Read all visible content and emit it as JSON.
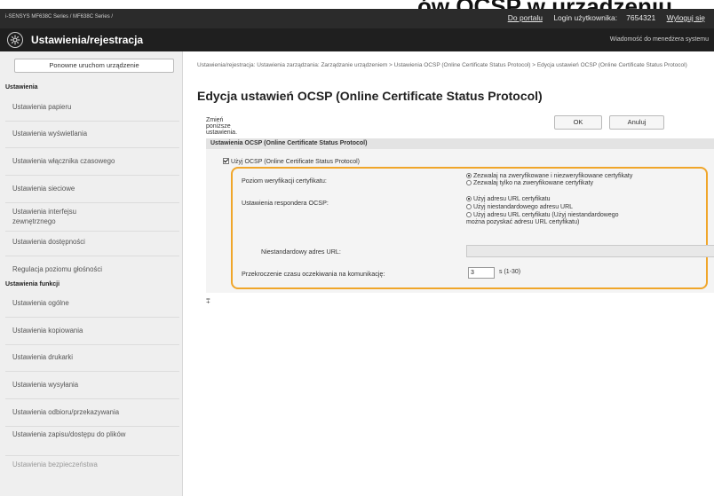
{
  "top_strip": {
    "overflow_text": "ów OCSP w urządzeniu"
  },
  "header": {
    "product": "i-SENSYS   MF638C Series / MF638C Series /",
    "portal_link": "Do portalu",
    "login_label": "Login użytkownika:",
    "user_id": "7654321",
    "logout_link": "Wyloguj się",
    "app_title": "Ustawienia/rejestracja",
    "message_link": "Wiadomość do menedżera systemu",
    "logo_icon": "settings-gear-icon"
  },
  "sidebar": {
    "restart_button": "Ponowne uruchom urządzenie",
    "section_settings": "Ustawienia",
    "settings_items": [
      "Ustawienia papieru",
      "Ustawienia wyświetlania",
      "Ustawienia włącznika czasowego",
      "Ustawienia sieciowe",
      "Ustawienia interfejsu zewnętrznego",
      "Ustawienia dostępności",
      "Regulacja poziomu głośności"
    ],
    "section_functions": "Ustawienia funkcji",
    "function_items": [
      "Ustawienia ogólne",
      "Ustawienia kopiowania",
      "Ustawienia drukarki",
      "Ustawienia wysyłania",
      "Ustawienia odbioru/przekazywania",
      "Ustawienia zapisu/dostępu do plików",
      "Ustawienia bezpieczeństwa"
    ]
  },
  "main": {
    "breadcrumb": "Ustawienia/rejestracja: Ustawienia zarządzania: Zarządzanie urządzeniem > Ustawienia OCSP (Online Certificate Status Protocol) > Edycja ustawień OCSP (Online Certificate Status Protocol)",
    "page_title": "Edycja ustawień OCSP (Online Certificate Status Protocol)",
    "hint": "Zmień poniższe ustawienia.",
    "ok_button": "OK",
    "cancel_button": "Anuluj",
    "section_title": "Ustawienia OCSP (Online Certificate Status Protocol)",
    "use_ocsp_label": "Użyj OCSP (Online Certificate Status Protocol)",
    "use_ocsp_checked": true,
    "verification_label": "Poziom weryfikacji certyfikatu:",
    "verification_options": [
      "Zezwalaj na zweryfikowane i niezweryfikowane certyfikaty",
      "Zezwalaj tylko na zweryfikowane certyfikaty"
    ],
    "verification_selected": 0,
    "responder_label": "Ustawienia respondera OCSP:",
    "responder_options": [
      "Użyj adresu URL certyfikatu",
      "Użyj niestandardowego adresu URL",
      "Użyj adresu URL certyfikatu (Użyj niestandardowego",
      "można pozyskać adresu URL certyfikatu)"
    ],
    "responder_selected": 0,
    "custom_url_label": "Niestandardowy adres URL:",
    "custom_url_value": "",
    "timeout_label": "Przekroczenie czasu oczekiwania na komunikację:",
    "timeout_value": "3",
    "timeout_unit": "s (1-30)",
    "to_top_icon": "scroll-to-top-icon",
    "to_top_glyph": "⩱"
  },
  "colors": {
    "highlight": "#f0a62a",
    "topbar": "#2b2b2b",
    "titlebar": "#1f1f1f"
  }
}
